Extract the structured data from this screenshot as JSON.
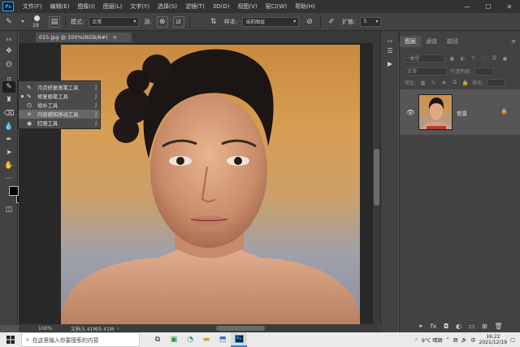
{
  "app": {
    "logo_text": "Ps",
    "menus": [
      "文件(F)",
      "编辑(E)",
      "图像(I)",
      "图层(L)",
      "文字(Y)",
      "选择(S)",
      "滤镜(T)",
      "3D(D)",
      "视图(V)",
      "窗口(W)",
      "帮助(H)"
    ],
    "window_controls": {
      "minimize": "—",
      "maximize": "☐",
      "close": "✕"
    }
  },
  "options": {
    "brush_size": "19",
    "mode_label": "模式:",
    "mode_value": "正常",
    "source_label": "源:",
    "sample_label": "样本:",
    "sample_value": "当前图层",
    "spread_label": "扩散:",
    "spread_value": "5"
  },
  "document": {
    "tab_title": "015.jpg @ 100%(RGB/8#)",
    "tab_close": "×",
    "zoom": "100%",
    "doc_size": "文档:5.41M/5.41M",
    "status_arrow": "›"
  },
  "flyout": {
    "items": [
      {
        "label": "污点修复画笔工具",
        "key": "J",
        "icon": "spot-healing-icon",
        "selected": false,
        "current": false
      },
      {
        "label": "修复画笔工具",
        "key": "J",
        "icon": "healing-brush-icon",
        "selected": false,
        "current": true
      },
      {
        "label": "修补工具",
        "key": "J",
        "icon": "patch-icon",
        "selected": false,
        "current": false
      },
      {
        "label": "内容感知移动工具",
        "key": "J",
        "icon": "content-aware-move-icon",
        "selected": true,
        "current": false
      },
      {
        "label": "红眼工具",
        "key": "J",
        "icon": "red-eye-icon",
        "selected": false,
        "current": false
      }
    ]
  },
  "layers_panel": {
    "tabs": [
      "图层",
      "通道",
      "路径"
    ],
    "filter_label": "类型",
    "blend_mode": "正常",
    "opacity_label": "不透明度:",
    "lock_label": "锁定:",
    "fill_label": "填充:",
    "layer_name": "背景"
  },
  "taskbar": {
    "search_placeholder": "在这里输入你要搜索的内容",
    "weather": "9°C 晴朗",
    "ime": "中",
    "time": "16:22",
    "date": "2021/12/19"
  }
}
